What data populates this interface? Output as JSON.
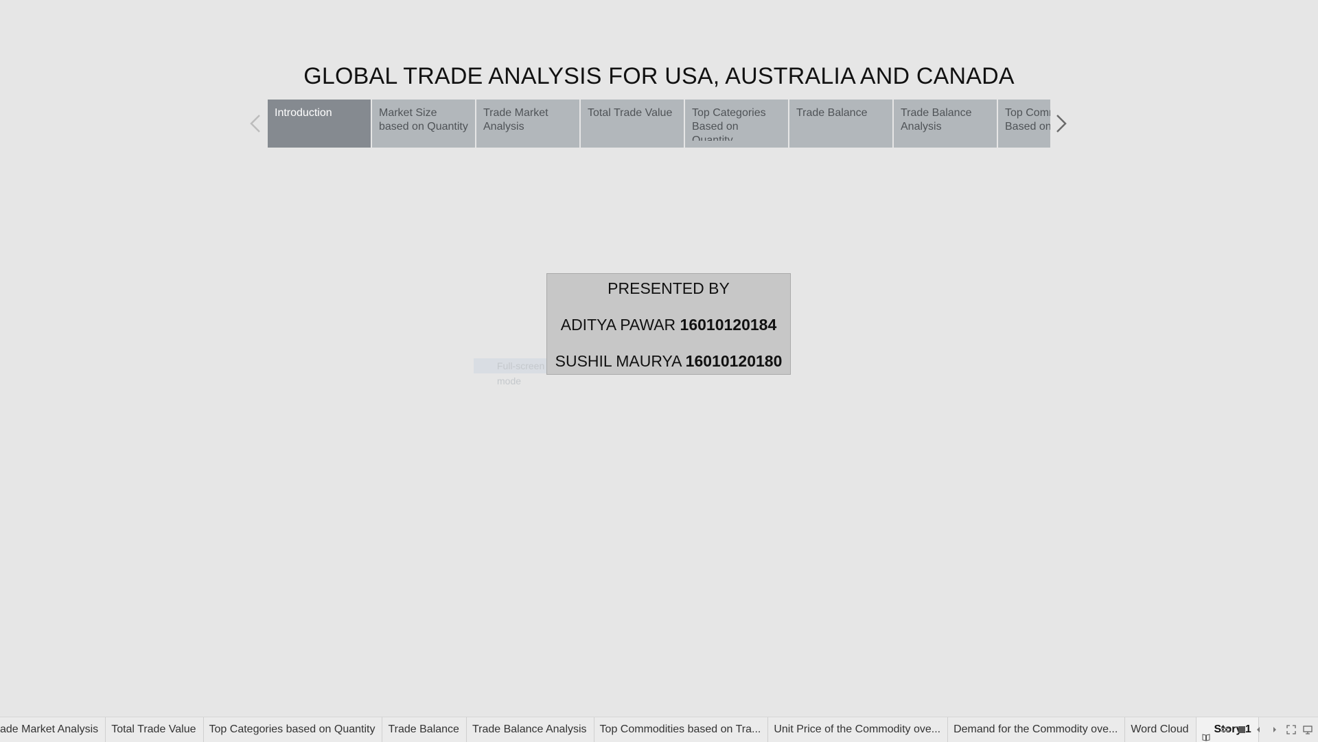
{
  "story": {
    "title": "GLOBAL TRADE ANALYSIS FOR USA, AUSTRALIA AND CANADA",
    "points": [
      {
        "label": "Introduction",
        "active": true
      },
      {
        "label": "Market Size based on Quantity",
        "active": false
      },
      {
        "label": "Trade Market Analysis",
        "active": false
      },
      {
        "label": "Total Trade Value",
        "active": false
      },
      {
        "label": "Top Categories Based on Quantity",
        "active": false
      },
      {
        "label": "Trade Balance",
        "active": false
      },
      {
        "label": "Trade Balance Analysis",
        "active": false
      },
      {
        "label": "Top Commodities Based on Value",
        "active": false
      }
    ],
    "prev_icon": "chevron-left-icon",
    "next_icon": "chevron-right-icon"
  },
  "presenter": {
    "heading": "PRESENTED BY",
    "people": [
      {
        "name": "ADITYA PAWAR",
        "id": "16010120184"
      },
      {
        "name": "SUSHIL MAURYA",
        "id": "16010120180"
      }
    ]
  },
  "overlay": {
    "hint": "Full-screen mode"
  },
  "tabbar": {
    "tabs": [
      "ade Market Analysis",
      "Total Trade Value",
      "Top Categories based on Quantity",
      "Trade Balance",
      "Trade Balance Analysis",
      "Top Commodities based on Tra...",
      "Unit Price of the Commodity ove...",
      "Demand for the Commodity ove...",
      "Word Cloud"
    ],
    "story_tab": "Story 1",
    "controls": [
      "filmstrip-icon",
      "tabs-icon",
      "prev-sheet-icon",
      "next-sheet-icon",
      "fullscreen-icon",
      "present-icon"
    ]
  },
  "colors": {
    "background": "#e6e6e6",
    "story_point_active": "#858a90",
    "story_point_inactive": "#b2b7bb",
    "presenter_box": "#c7c7c7"
  }
}
